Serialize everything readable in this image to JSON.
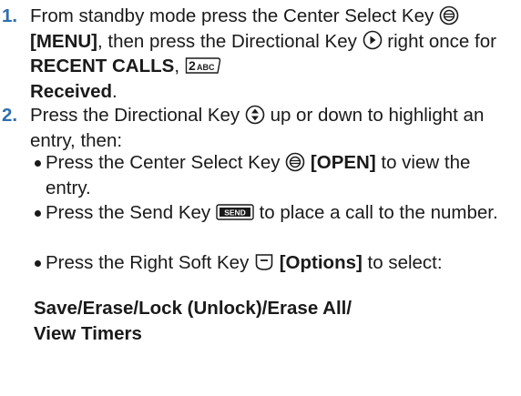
{
  "step1": {
    "number": "1.",
    "t1": "From standby mode press the Center Select Key",
    "k1": "[MENU]",
    "t2": ", then press the Directional Key",
    "t3": "right once for",
    "k2": "RECENT CALLS",
    "t4": ",",
    "k3": "Received",
    "t5": "."
  },
  "step2": {
    "number": "2.",
    "t1": "Press the Directional Key",
    "t2": "up or down to highlight an entry, then:",
    "bullets": [
      {
        "t1": "Press the Center Select Key",
        "k": "[OPEN]",
        "t2": "to view the entry."
      },
      {
        "t1": "Press the Send Key",
        "t2": "to place a call to the number."
      },
      {
        "t1": "Press the Right Soft Key",
        "k": "[Options]",
        "t2": "to select:"
      }
    ],
    "options_line1": "Save/Erase/Lock (Unlock)/Erase All/",
    "options_line2": "View Timers"
  },
  "icons": {
    "send_key_text": "SEND",
    "two_key_text": "2ABC"
  }
}
